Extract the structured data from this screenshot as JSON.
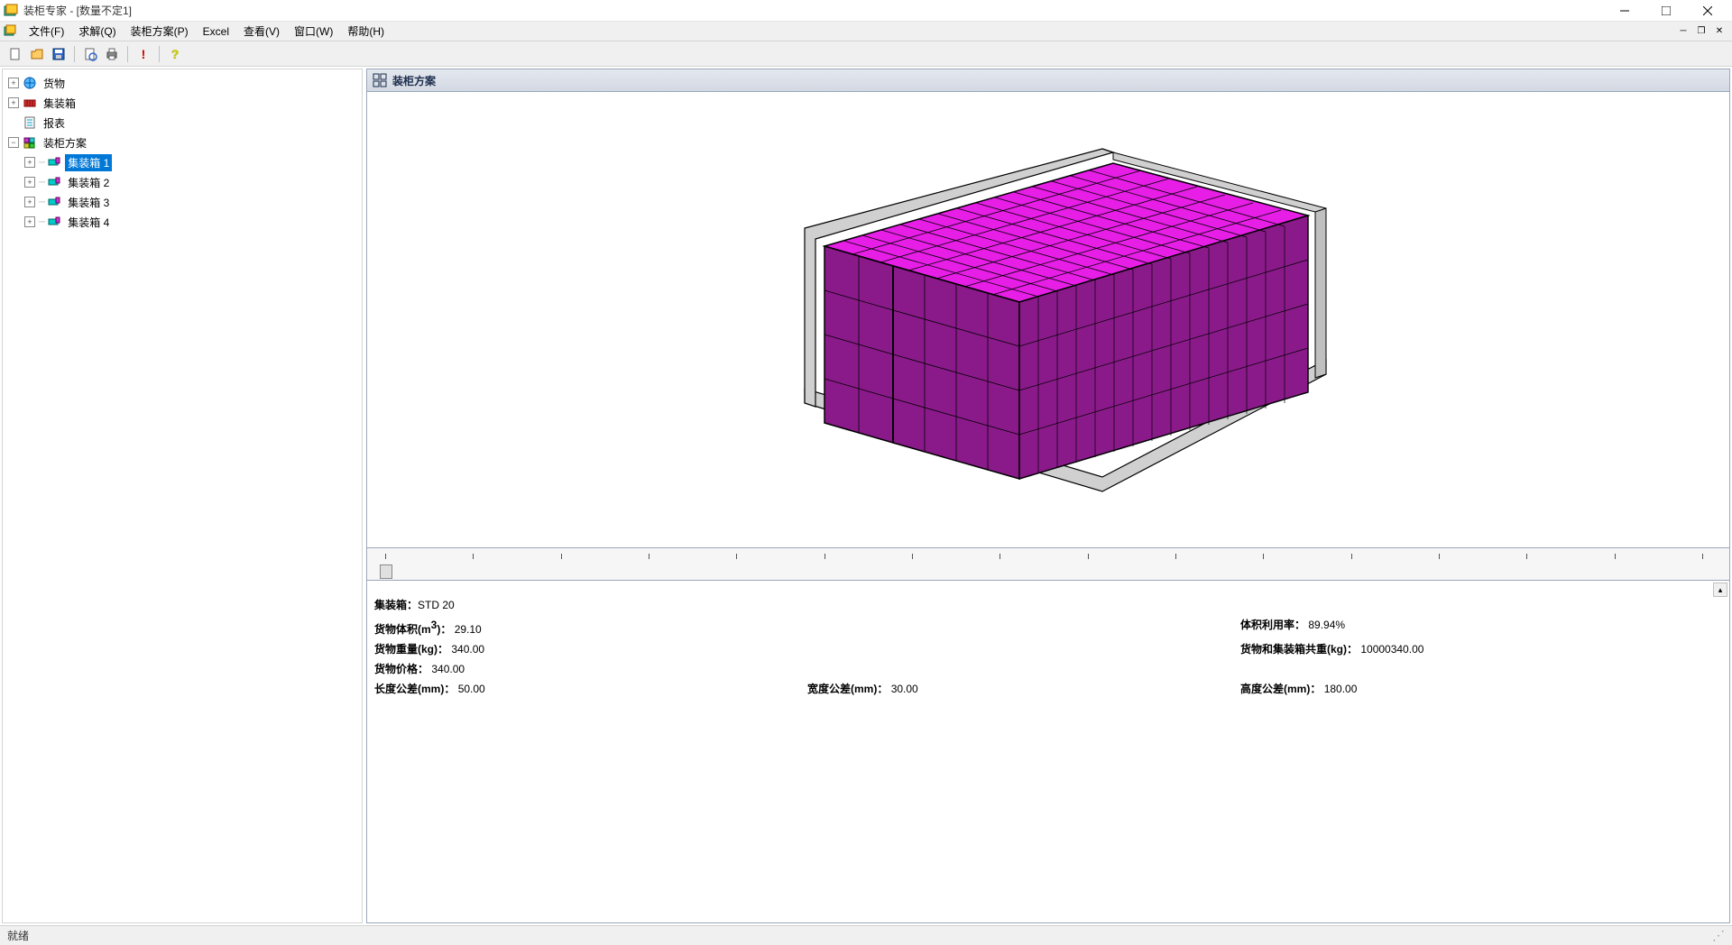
{
  "window": {
    "title": "装柜专家 - [数量不定1]"
  },
  "menu": {
    "file": "文件(F)",
    "solve": "求解(Q)",
    "plan": "装柜方案(P)",
    "excel": "Excel",
    "view": "查看(V)",
    "window": "窗口(W)",
    "help": "帮助(H)"
  },
  "tree": {
    "n1": "货物",
    "n2": "集装箱",
    "n3": "报表",
    "n4": "装柜方案",
    "n4_1": "集装箱 1",
    "n4_2": "集装箱 2",
    "n4_3": "集装箱 3",
    "n4_4": "集装箱 4"
  },
  "panel": {
    "title": "装柜方案"
  },
  "info": {
    "container_label": "集装箱：",
    "container_value": "STD 20",
    "volume_label": "货物体积(m",
    "volume_sup": "3",
    "volume_label2": ")：",
    "volume_value": "29.10",
    "util_label": "体积利用率：",
    "util_value": "89.94%",
    "weight_label": "货物重量(kg)：",
    "weight_value": "340.00",
    "total_weight_label": "货物和集装箱共重(kg)：",
    "total_weight_value": "10000340.00",
    "price_label": "货物价格：",
    "price_value": "340.00",
    "len_tol_label": "长度公差(mm)：",
    "len_tol_value": "50.00",
    "wid_tol_label": "宽度公差(mm)：",
    "wid_tol_value": "30.00",
    "hgt_tol_label": "高度公差(mm)：",
    "hgt_tol_value": "180.00"
  },
  "status": {
    "ready": "就绪"
  }
}
